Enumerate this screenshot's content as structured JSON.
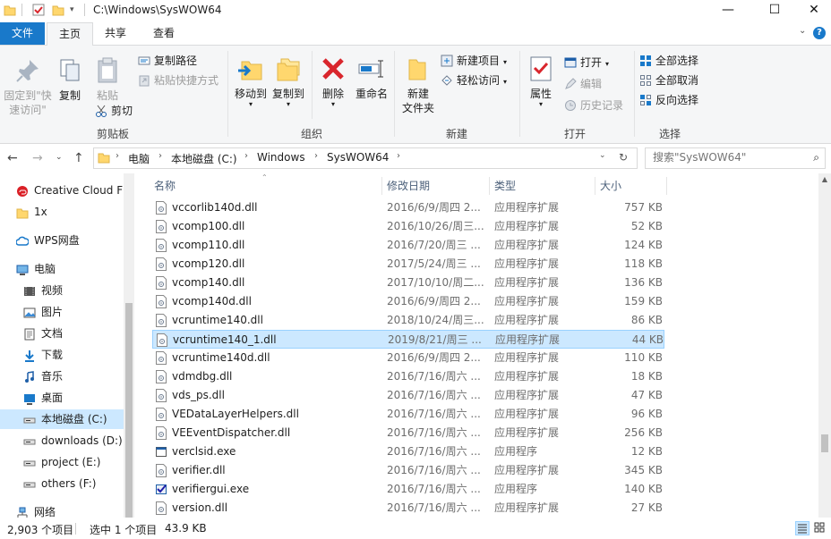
{
  "window": {
    "title": "C:\\Windows\\SysWOW64",
    "minimize": "—",
    "maximize": "☐",
    "close": "✕"
  },
  "tabs": {
    "file": "文件",
    "home": "主页",
    "share": "共享",
    "view": "查看"
  },
  "ribbon": {
    "clipboard": {
      "label": "剪贴板",
      "pin": "固定到\"快速访问\"",
      "pin_line1": "固定到\"快",
      "pin_line2": "速访问\"",
      "copy": "复制",
      "paste": "粘贴",
      "copy_path": "复制路径",
      "paste_shortcut": "粘贴快捷方式",
      "cut": "剪切"
    },
    "organize": {
      "label": "组织",
      "move_to": "移动到",
      "copy_to": "复制到",
      "delete": "删除",
      "rename": "重命名"
    },
    "new": {
      "label": "新建",
      "new_folder_line1": "新建",
      "new_folder_line2": "文件夹",
      "new_item": "新建项目",
      "easy_access": "轻松访问"
    },
    "open": {
      "label": "打开",
      "properties": "属性",
      "open": "打开",
      "edit": "编辑",
      "history": "历史记录"
    },
    "select": {
      "label": "选择",
      "select_all": "全部选择",
      "select_none": "全部取消",
      "invert": "反向选择"
    }
  },
  "address": {
    "crumbs": [
      "电脑",
      "本地磁盘 (C:)",
      "Windows",
      "SysWOW64"
    ],
    "search_placeholder": "搜索\"SysWOW64\""
  },
  "nav": {
    "items": [
      {
        "label": "Creative Cloud F",
        "icon": "creative-cloud-icon"
      },
      {
        "label": "1x",
        "icon": "folder-icon"
      },
      {
        "label": "WPS网盘",
        "icon": "cloud-icon"
      },
      {
        "label": "电脑",
        "icon": "computer-icon"
      },
      {
        "label": "视频",
        "icon": "video-folder-icon"
      },
      {
        "label": "图片",
        "icon": "pictures-folder-icon"
      },
      {
        "label": "文档",
        "icon": "documents-folder-icon"
      },
      {
        "label": "下载",
        "icon": "downloads-folder-icon"
      },
      {
        "label": "音乐",
        "icon": "music-folder-icon"
      },
      {
        "label": "桌面",
        "icon": "desktop-folder-icon"
      },
      {
        "label": "本地磁盘 (C:)",
        "icon": "drive-icon"
      },
      {
        "label": "downloads (D:)",
        "icon": "drive-icon"
      },
      {
        "label": "project (E:)",
        "icon": "drive-icon"
      },
      {
        "label": "others (F:)",
        "icon": "drive-icon"
      },
      {
        "label": "网络",
        "icon": "network-icon"
      }
    ]
  },
  "list": {
    "headers": {
      "name": "名称",
      "date": "修改日期",
      "type": "类型",
      "size": "大小"
    },
    "rows": [
      {
        "name": "vccorlib140d.dll",
        "date": "2016/6/9/周四 2...",
        "type": "应用程序扩展",
        "size": "757 KB",
        "icon": "dll-icon"
      },
      {
        "name": "vcomp100.dll",
        "date": "2016/10/26/周三...",
        "type": "应用程序扩展",
        "size": "52 KB",
        "icon": "dll-icon"
      },
      {
        "name": "vcomp110.dll",
        "date": "2016/7/20/周三 ...",
        "type": "应用程序扩展",
        "size": "124 KB",
        "icon": "dll-icon"
      },
      {
        "name": "vcomp120.dll",
        "date": "2017/5/24/周三 ...",
        "type": "应用程序扩展",
        "size": "118 KB",
        "icon": "dll-icon"
      },
      {
        "name": "vcomp140.dll",
        "date": "2017/10/10/周二...",
        "type": "应用程序扩展",
        "size": "136 KB",
        "icon": "dll-icon"
      },
      {
        "name": "vcomp140d.dll",
        "date": "2016/6/9/周四 2...",
        "type": "应用程序扩展",
        "size": "159 KB",
        "icon": "dll-icon"
      },
      {
        "name": "vcruntime140.dll",
        "date": "2018/10/24/周三...",
        "type": "应用程序扩展",
        "size": "86 KB",
        "icon": "dll-icon"
      },
      {
        "name": "vcruntime140_1.dll",
        "date": "2019/8/21/周三 ...",
        "type": "应用程序扩展",
        "size": "44 KB",
        "icon": "dll-icon",
        "selected": true
      },
      {
        "name": "vcruntime140d.dll",
        "date": "2016/6/9/周四 2...",
        "type": "应用程序扩展",
        "size": "110 KB",
        "icon": "dll-icon"
      },
      {
        "name": "vdmdbg.dll",
        "date": "2016/7/16/周六 ...",
        "type": "应用程序扩展",
        "size": "18 KB",
        "icon": "dll-icon"
      },
      {
        "name": "vds_ps.dll",
        "date": "2016/7/16/周六 ...",
        "type": "应用程序扩展",
        "size": "47 KB",
        "icon": "dll-icon"
      },
      {
        "name": "VEDataLayerHelpers.dll",
        "date": "2016/7/16/周六 ...",
        "type": "应用程序扩展",
        "size": "96 KB",
        "icon": "dll-icon"
      },
      {
        "name": "VEEventDispatcher.dll",
        "date": "2016/7/16/周六 ...",
        "type": "应用程序扩展",
        "size": "256 KB",
        "icon": "dll-icon"
      },
      {
        "name": "verclsid.exe",
        "date": "2016/7/16/周六 ...",
        "type": "应用程序",
        "size": "12 KB",
        "icon": "exe-icon"
      },
      {
        "name": "verifier.dll",
        "date": "2016/7/16/周六 ...",
        "type": "应用程序扩展",
        "size": "345 KB",
        "icon": "dll-icon"
      },
      {
        "name": "verifiergui.exe",
        "date": "2016/7/16/周六 ...",
        "type": "应用程序",
        "size": "140 KB",
        "icon": "verifier-exe-icon"
      },
      {
        "name": "version.dll",
        "date": "2016/7/16/周六 ...",
        "type": "应用程序扩展",
        "size": "27 KB",
        "icon": "dll-icon"
      }
    ]
  },
  "status": {
    "count": "2,903 个项目",
    "selected": "选中 1 个项目",
    "size": "43.9 KB"
  },
  "colors": {
    "accent": "#1979ca",
    "selection_bg": "#cce8ff",
    "selection_border": "#99d1ff",
    "folder": "#ffd76e",
    "delete_red": "#d9262d"
  }
}
